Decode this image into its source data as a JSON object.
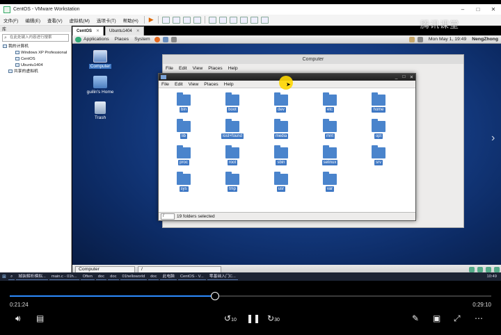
{
  "window": {
    "title": "CentOS - VMware Workstation",
    "controls": [
      "–",
      "□",
      "✕"
    ]
  },
  "vmware_menu": [
    "文件(F)",
    "编辑(E)",
    "查看(V)",
    "虚拟机(M)",
    "选项卡(T)",
    "帮助(H)"
  ],
  "watermark": "腾讯课堂",
  "library": {
    "header": "库",
    "search_placeholder": "在此处键入内容进行搜索",
    "items": [
      "我的计算机",
      "Windows XP Professional",
      "CentOS",
      "Ubuntu1404",
      "共享的虚拟机"
    ]
  },
  "vm_tabs": [
    {
      "label": "CentOS",
      "active": true
    },
    {
      "label": "Ubuntu1404",
      "active": false
    }
  ],
  "gnome_panel": {
    "menus": [
      "Applications",
      "Places",
      "System"
    ],
    "clock": "Mon May  1, 19:49",
    "user": "NengZhong"
  },
  "desktop_icons": [
    "Computer",
    "guilin's Home",
    "Trash"
  ],
  "back_window": {
    "title": "Computer",
    "menu": [
      "File",
      "Edit",
      "View",
      "Places",
      "Help"
    ]
  },
  "front_window": {
    "menu": [
      "File",
      "Edit",
      "View",
      "Places",
      "Help"
    ],
    "folders": [
      "bin",
      "boot",
      "dev",
      "etc",
      "home",
      "lib",
      "lost+found",
      "media",
      "mnt",
      "opt",
      "proc",
      "root",
      "sbin",
      "selinux",
      "srv",
      "sys",
      "tmp",
      "usr",
      "var"
    ],
    "location": "/",
    "status": "19 folders selected"
  },
  "gnome_taskbar": [
    "Computer",
    "/"
  ],
  "win_taskbar": {
    "items": [
      "城装解析模拟...",
      "main.c - 01h...",
      "Often",
      "doc",
      "doc",
      "01helloworld",
      "doc",
      "此电脑",
      "CentOS - V...",
      "零基础入门C..."
    ],
    "clock": "10:49"
  },
  "player": {
    "current_time": "0:21:24",
    "total_time": "0:29:10",
    "progress": 0.426,
    "skip_back": "10",
    "skip_forward": "30"
  }
}
